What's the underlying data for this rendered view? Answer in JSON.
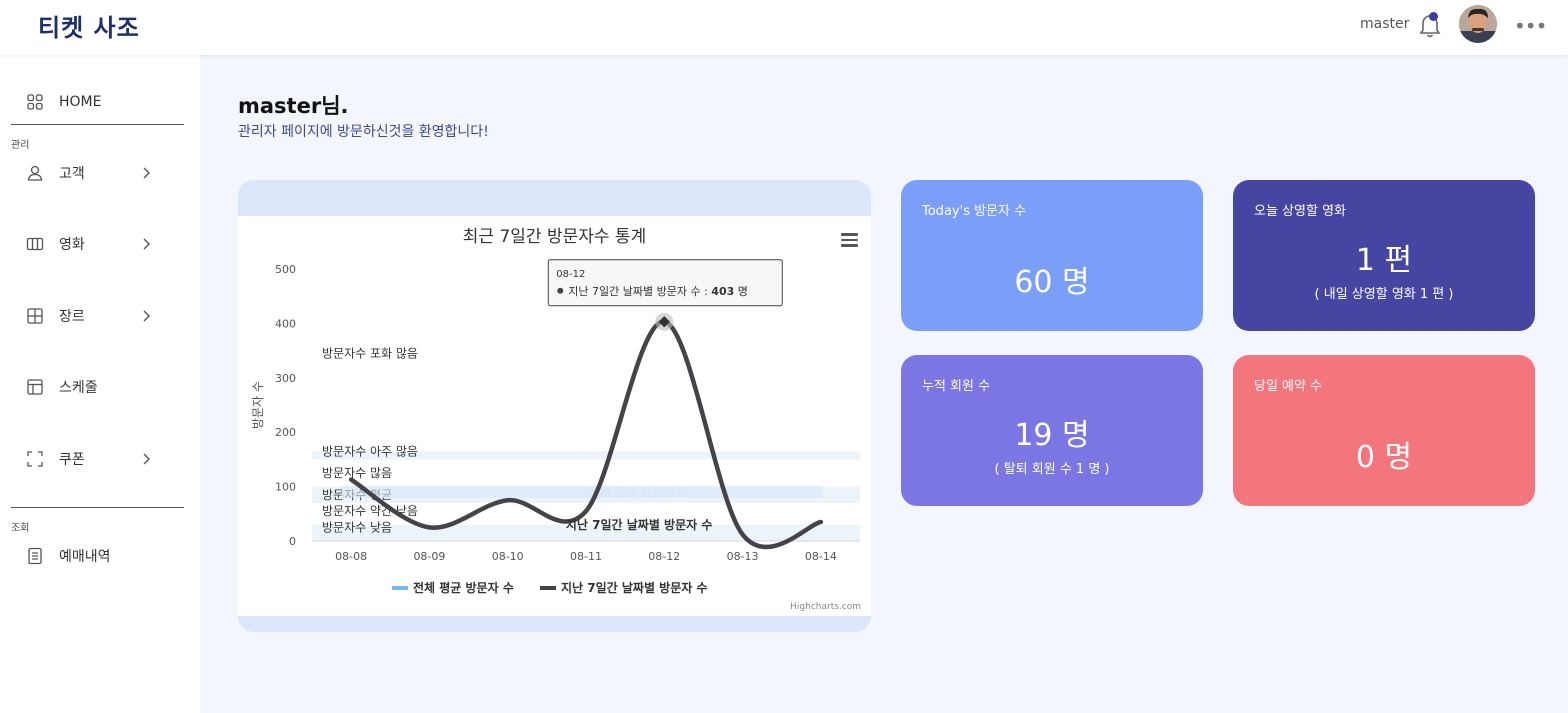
{
  "header": {
    "brand": "티켓 사조",
    "user": "master",
    "more": "•••"
  },
  "sidebar": {
    "home": "HOME",
    "group_manage": "관리",
    "items": [
      {
        "label": "고객",
        "icon": "user-icon"
      },
      {
        "label": "영화",
        "icon": "film-icon"
      },
      {
        "label": "장르",
        "icon": "grid-icon"
      },
      {
        "label": "스케줄",
        "icon": "layout-icon"
      },
      {
        "label": "쿠폰",
        "icon": "scan-icon"
      }
    ],
    "group_view": "조회",
    "view_items": [
      {
        "label": "예매내역",
        "icon": "document-icon"
      }
    ]
  },
  "welcome": {
    "title": "master님.",
    "subtitle": "관리자 페이지에 방문하신것을 환영합니다!"
  },
  "chart_data": {
    "type": "line",
    "title": "최근 7일간 방문자수 통계",
    "ylabel": "방문자 수",
    "xlabel": "",
    "ylim": [
      0,
      500
    ],
    "yticks": [
      0,
      100,
      200,
      300,
      400,
      500
    ],
    "categories": [
      "08-08",
      "08-09",
      "08-10",
      "08-11",
      "08-12",
      "08-13",
      "08-14"
    ],
    "series": [
      {
        "name": "전체 평균 방문자 수",
        "values": [
          90,
          90,
          90,
          90,
          90,
          90,
          90
        ],
        "color": "#7cb5ec"
      },
      {
        "name": "지난 7일간 날짜별 방문자 수",
        "values": [
          113,
          25,
          75,
          55,
          403,
          12,
          35
        ],
        "color": "#434348"
      }
    ],
    "plot_bands": [
      {
        "label": "방문자수 포화 많음"
      },
      {
        "label": "방문자수 아주 많음"
      },
      {
        "label": "방문자수 많음"
      },
      {
        "label": "방문자수 평균"
      },
      {
        "label": "방문자수 약간 낮음"
      },
      {
        "label": "방문자수 낮음"
      }
    ],
    "series_labels": [
      "전체 평균 방문자 수",
      "지난 7일간 날짜별 방문자 수"
    ],
    "tooltip": {
      "date": "08-12",
      "series": "지난 7일간 날짜별 방문자 수",
      "separator": " : ",
      "value": "403",
      "unit": "명"
    },
    "legend": [
      "전체 평균 방문자 수",
      "지난 7일간 날짜별 방문자 수"
    ],
    "legend_position": "bottom-center",
    "credits": "Highcharts.com",
    "grid": false
  },
  "stats": {
    "today_visitors": {
      "title": "Today's 방문자 수",
      "value": "60 명",
      "color": "#7b9ef8"
    },
    "today_movies": {
      "title": "오늘 상영할 영화",
      "value": "1 편",
      "sub": "( 내일 상영할 영화 1 편 )",
      "color": "#4745a2"
    },
    "members": {
      "title": "누적 회원 수",
      "value": "19 명",
      "sub": "( 탈퇴 회원 수 1 명 )",
      "color": "#7b76e3"
    },
    "reservations": {
      "title": "당일 예약 수",
      "value": "0 명",
      "color": "#f2767b"
    }
  }
}
